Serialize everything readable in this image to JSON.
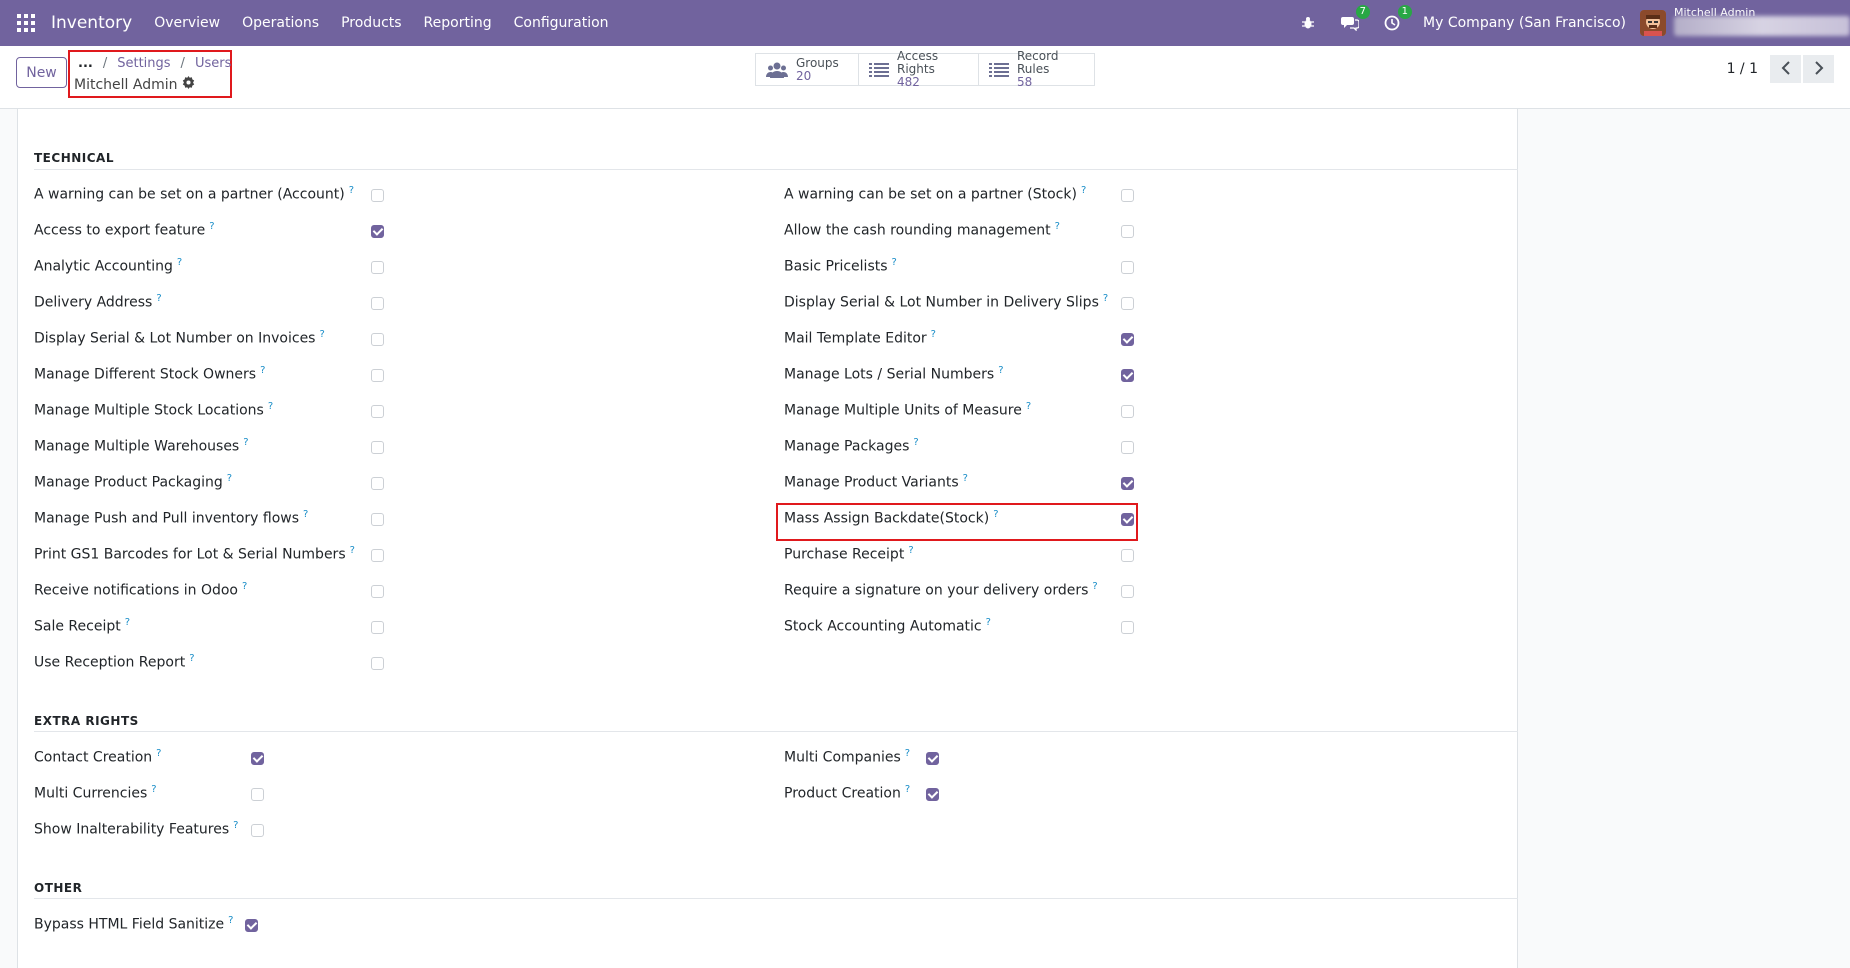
{
  "navbar": {
    "app_title": "Inventory",
    "menu": [
      "Overview",
      "Operations",
      "Products",
      "Reporting",
      "Configuration"
    ],
    "messages_badge": "7",
    "activities_badge": "1",
    "company": "My Company (San Francisco)",
    "user": "Mitchell Admin",
    "bg_color": "#71639e"
  },
  "control": {
    "new_label": "New",
    "breadcrumb": {
      "ellipsis": "...",
      "items": [
        "Settings",
        "Users"
      ]
    },
    "record_name": "Mitchell Admin",
    "stats": [
      {
        "label": "Groups",
        "value": "20",
        "icon": "groups-icon"
      },
      {
        "label": "Access Rights",
        "value": "482",
        "icon": "list-icon"
      },
      {
        "label": "Record Rules",
        "value": "58",
        "icon": "list-icon"
      }
    ],
    "pager": "1 / 1"
  },
  "sections": {
    "technical": {
      "title": "TECHNICAL",
      "left": [
        {
          "label": "A warning can be set on a partner (Account)",
          "checked": false
        },
        {
          "label": "Access to export feature",
          "checked": true
        },
        {
          "label": "Analytic Accounting",
          "checked": false
        },
        {
          "label": "Delivery Address",
          "checked": false
        },
        {
          "label": "Display Serial & Lot Number on Invoices",
          "checked": false
        },
        {
          "label": "Manage Different Stock Owners",
          "checked": false
        },
        {
          "label": "Manage Multiple Stock Locations",
          "checked": false
        },
        {
          "label": "Manage Multiple Warehouses",
          "checked": false
        },
        {
          "label": "Manage Product Packaging",
          "checked": false
        },
        {
          "label": "Manage Push and Pull inventory flows",
          "checked": false
        },
        {
          "label": "Print GS1 Barcodes for Lot & Serial Numbers",
          "checked": false
        },
        {
          "label": "Receive notifications in Odoo",
          "checked": false
        },
        {
          "label": "Sale Receipt",
          "checked": false
        },
        {
          "label": "Use Reception Report",
          "checked": false
        }
      ],
      "right": [
        {
          "label": "A warning can be set on a partner (Stock)",
          "checked": false
        },
        {
          "label": "Allow the cash rounding management",
          "checked": false
        },
        {
          "label": "Basic Pricelists",
          "checked": false
        },
        {
          "label": "Display Serial & Lot Number in Delivery Slips",
          "checked": false
        },
        {
          "label": "Mail Template Editor",
          "checked": true
        },
        {
          "label": "Manage Lots / Serial Numbers",
          "checked": true
        },
        {
          "label": "Manage Multiple Units of Measure",
          "checked": false
        },
        {
          "label": "Manage Packages",
          "checked": false
        },
        {
          "label": "Manage Product Variants",
          "checked": true
        },
        {
          "label": "Mass Assign Backdate(Stock)",
          "checked": true
        },
        {
          "label": "Purchase Receipt",
          "checked": false
        },
        {
          "label": "Require a signature on your delivery orders",
          "checked": false
        },
        {
          "label": "Stock Accounting Automatic",
          "checked": false
        }
      ]
    },
    "extra_rights": {
      "title": "EXTRA RIGHTS",
      "left": [
        {
          "label": "Contact Creation",
          "checked": true
        },
        {
          "label": "Multi Currencies",
          "checked": false
        },
        {
          "label": "Show Inalterability Features",
          "checked": false
        }
      ],
      "right": [
        {
          "label": "Multi Companies",
          "checked": true
        },
        {
          "label": "Product Creation",
          "checked": true
        }
      ]
    },
    "other": {
      "title": "OTHER",
      "left": [
        {
          "label": "Bypass HTML Field Sanitize",
          "checked": true
        }
      ]
    },
    "help_mark": "?"
  }
}
